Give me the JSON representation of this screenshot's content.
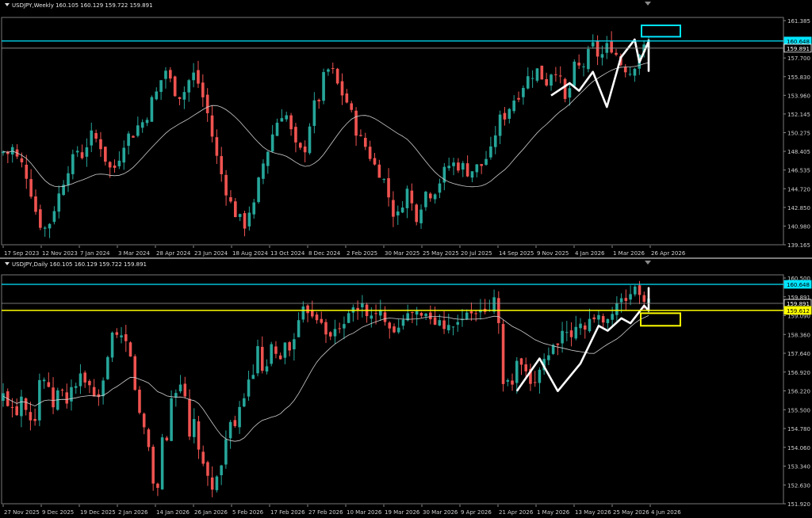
{
  "weekly": {
    "header": "USDJPY,Weekly  160.105 160.129 159.722 159.891",
    "colors": {
      "bull": "#26a69a",
      "bear": "#ef5350",
      "ma": "#cfcfcf",
      "zigzag": "#ffffff",
      "cyan": "#00e5ff",
      "price": "#ffffff"
    }
  },
  "daily": {
    "header": "USDJPY,Daily  160.105 160.129 159.722 159.891",
    "colors": {
      "bull": "#26a69a",
      "bear": "#ef5350",
      "ma": "#cfcfcf",
      "zigzag": "#ffffff",
      "cyan": "#00e5ff",
      "yellow": "#ffff00",
      "price": "#ffffff"
    }
  },
  "chart_data": [
    {
      "type": "candlestick",
      "title": "USDJPY,Weekly",
      "ylim": [
        139.165,
        162.8
      ],
      "y_ticks": [
        "161.385",
        "159.570",
        "157.700",
        "155.830",
        "153.960",
        "152.145",
        "150.275",
        "148.405",
        "146.535",
        "144.720",
        "142.850",
        "140.980",
        "139.165"
      ],
      "x_ticks": [
        "17 Sep 2023",
        "12 Nov 2023",
        "7 Jan 2024",
        "3 Mar 2024",
        "28 Apr 2024",
        "23 Jun 2024",
        "18 Aug 2024",
        "13 Oct 2024",
        "8 Dec 2024",
        "2 Feb 2025",
        "30 Mar 2025",
        "25 May 2025",
        "20 Jul 2025",
        "14 Sep 2025",
        "9 Nov 2025",
        "4 Jan 2026",
        "1 Mar 2026",
        "26 Apr 2026"
      ],
      "price_labels": [
        {
          "value": 160.648,
          "text": "160.648",
          "role": "cyan-line"
        },
        {
          "value": 159.891,
          "text": "159.891",
          "role": "current"
        }
      ],
      "y_anchors": [
        149.0,
        148.8,
        149.4,
        148.0,
        147.5,
        146.2,
        144.0,
        141.9,
        141.0,
        140.8,
        142.6,
        143.9,
        145.6,
        147.2,
        147.9,
        149.2,
        148.6,
        149.8,
        150.7,
        150.2,
        149.5,
        147.8,
        146.9,
        147.6,
        149.3,
        150.8,
        150.5,
        151.6,
        151.9,
        152.6,
        154.2,
        155.0,
        156.5,
        157.6,
        156.3,
        155.3,
        154.9,
        155.5,
        156.9,
        157.2,
        155.5,
        154.0,
        151.8,
        149.0,
        147.1,
        145.4,
        143.7,
        142.6,
        141.8,
        141.3,
        142.9,
        143.2,
        146.2,
        148.2,
        149.6,
        151.5,
        152.6,
        153.4,
        152.1,
        149.6,
        149.1,
        148.7,
        151.5,
        153.7,
        154.4,
        156.7,
        157.6,
        157.3,
        155.8,
        154.9,
        154.0,
        152.3,
        150.7,
        149.8,
        149.3,
        147.7,
        147.2,
        146.4,
        144.7,
        142.7,
        142.0,
        143.7,
        144.9,
        143.3,
        142.1,
        143.8,
        145.0,
        144.5,
        145.3,
        146.3,
        147.3,
        147.8,
        147.5,
        147.6,
        146.9,
        147.0,
        147.3,
        147.5,
        148.3,
        148.9,
        151.2,
        152.6,
        152.9,
        154.0,
        154.8,
        155.4,
        156.6,
        156.9,
        157.7,
        157.3,
        156.0,
        157.3,
        158.0,
        156.5,
        154.2,
        155.7,
        158.0,
        157.8,
        158.2,
        159.5,
        160.3,
        158.6,
        159.6,
        160.3,
        159.8,
        158.4,
        158.1,
        157.2,
        158.1,
        159.4,
        159.8,
        159.9
      ]
    },
    {
      "type": "candlestick",
      "title": "USDJPY,Daily",
      "ylim": [
        151.92,
        160.9
      ],
      "y_ticks": [
        "160.500",
        "159.891",
        "159.090",
        "158.360",
        "157.640",
        "156.920",
        "156.220",
        "155.500",
        "154.780",
        "154.060",
        "153.340",
        "152.630",
        "151.920"
      ],
      "x_ticks": [
        "27 Nov 2025",
        "9 Dec 2025",
        "19 Dec 2025",
        "2 Jan 2026",
        "14 Jan 2026",
        "26 Jan 2026",
        "5 Feb 2026",
        "17 Feb 2026",
        "27 Feb 2026",
        "10 Mar 2026",
        "19 Mar 2026",
        "30 Mar 2026",
        "9 Apr 2026",
        "21 Apr 2026",
        "1 May 2026",
        "13 May 2026",
        "25 May 2026",
        "4 Jun 2026"
      ],
      "price_labels": [
        {
          "value": 160.648,
          "text": "160.648",
          "role": "cyan-line"
        },
        {
          "value": 159.891,
          "text": "159.891",
          "role": "current"
        },
        {
          "value": 159.612,
          "text": "159.612",
          "role": "yellow-line"
        }
      ],
      "y_anchors": [
        156.2,
        156.0,
        155.8,
        155.6,
        156.3,
        155.9,
        155.5,
        155.0,
        156.8,
        157.0,
        156.5,
        155.7,
        156.3,
        156.5,
        155.8,
        156.6,
        156.4,
        157.2,
        156.4,
        157.0,
        156.1,
        155.8,
        156.2,
        157.2,
        158.8,
        158.5,
        158.3,
        158.5,
        158.1,
        157.4,
        156.1,
        155.0,
        154.9,
        153.8,
        152.3,
        152.8,
        155.1,
        154.3,
        156.6,
        156.5,
        156.8,
        155.8,
        154.3,
        155.2,
        154.1,
        153.2,
        152.9,
        152.7,
        152.9,
        153.4,
        154.7,
        155.2,
        154.7,
        155.5,
        156.3,
        156.7,
        157.0,
        158.1,
        157.3,
        157.0,
        158.1,
        157.8,
        157.6,
        158.4,
        157.8,
        158.6,
        158.8,
        159.4,
        159.7,
        159.6,
        159.5,
        159.2,
        159.4,
        158.3,
        158.6,
        159.0,
        158.8,
        159.5,
        159.7,
        159.4,
        159.9,
        159.7,
        159.5,
        159.2,
        159.4,
        159.5,
        159.3,
        159.1,
        158.7,
        159.2,
        159.5,
        159.3,
        159.6,
        159.5,
        159.3,
        159.4,
        159.3,
        159.0,
        159.2,
        159.1,
        159.2,
        158.8,
        159.3,
        159.4,
        159.3,
        159.5,
        159.5,
        159.6,
        159.4,
        159.7,
        159.9,
        160.3,
        156.6,
        156.8,
        156.5,
        157.3,
        157.6,
        157.3,
        156.5,
        156.4,
        157.2,
        157.6,
        157.8,
        158.0,
        158.3,
        158.6,
        158.6,
        158.5,
        158.7,
        158.9,
        159.0,
        159.1,
        159.3,
        159.1,
        159.3,
        159.4,
        159.2,
        159.6,
        159.8,
        159.9,
        160.1,
        160.3,
        160.6,
        160.3,
        159.8,
        159.9
      ]
    }
  ]
}
